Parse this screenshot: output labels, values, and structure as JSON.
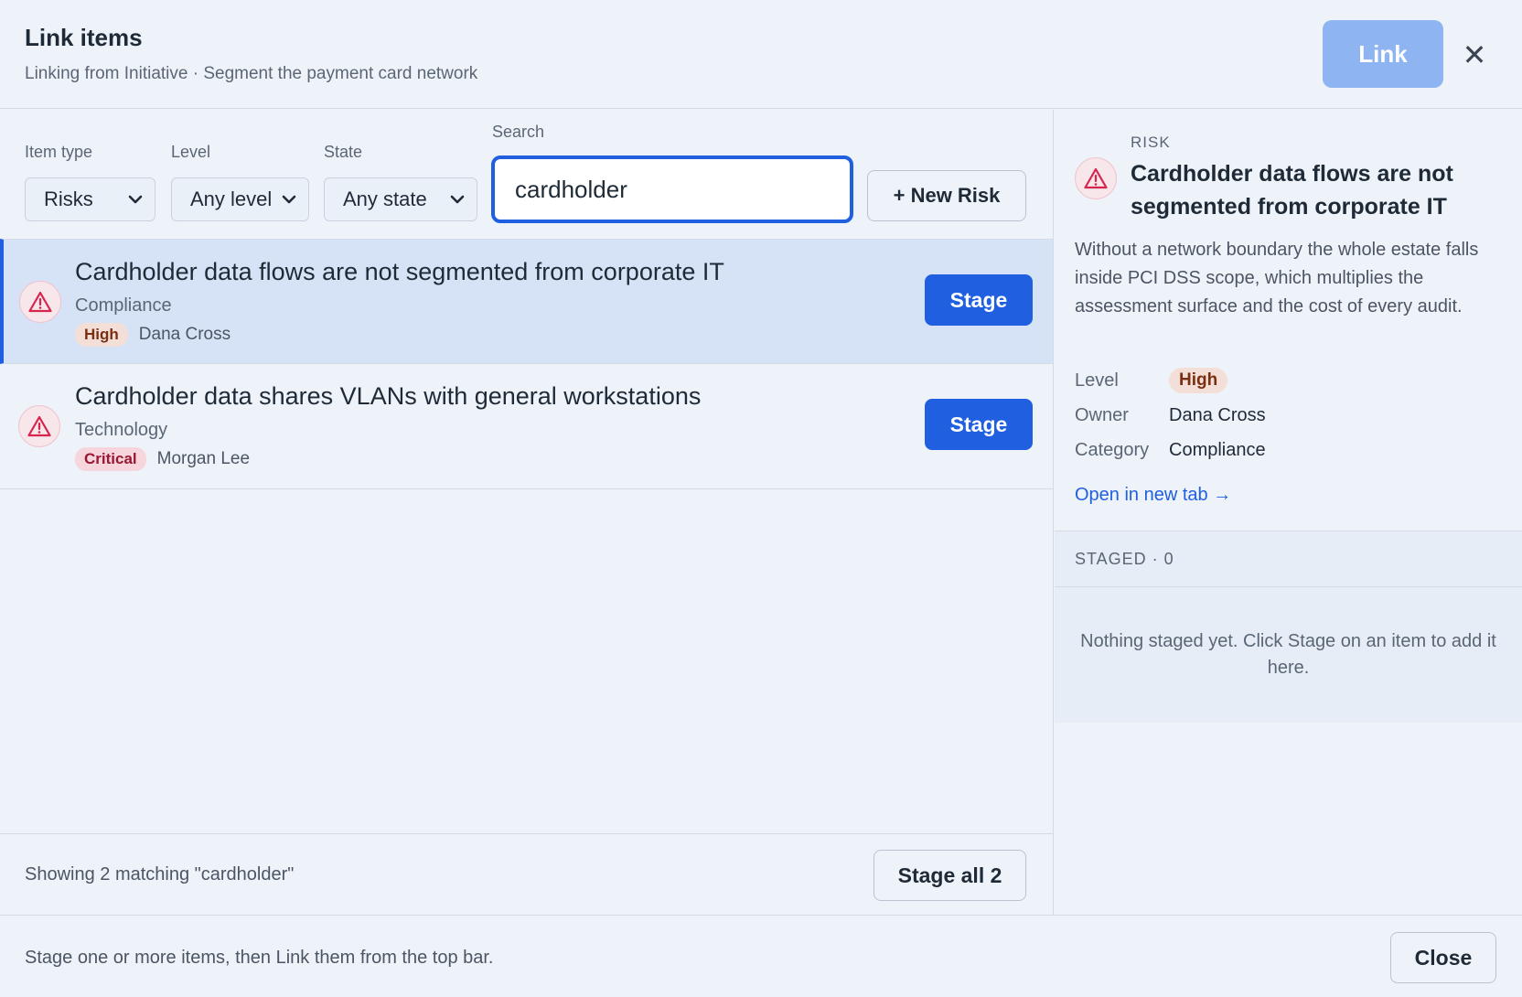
{
  "header": {
    "title": "Link items",
    "subtitle": "Linking from Initiative · Segment the payment card network",
    "link_label": "Link",
    "close_glyph": "✕"
  },
  "filters": {
    "item_type": {
      "label": "Item type",
      "value": "Risks"
    },
    "level": {
      "label": "Level",
      "value": "Any level"
    },
    "state": {
      "label": "State",
      "value": "Any state"
    },
    "search": {
      "label": "Search",
      "value": "cardholder"
    },
    "new_button": "+ New Risk"
  },
  "results": [
    {
      "title": "Cardholder data flows are not segmented from corporate IT",
      "category": "Compliance",
      "level": "High",
      "owner": "Dana Cross",
      "action": "Stage",
      "selected": true
    },
    {
      "title": "Cardholder data shares VLANs with general workstations",
      "category": "Technology",
      "level": "Critical",
      "owner": "Morgan Lee",
      "action": "Stage",
      "selected": false
    }
  ],
  "list_footer": {
    "showing": "Showing 2 matching \"cardholder\"",
    "stage_all": "Stage all 2"
  },
  "detail": {
    "kind": "RISK",
    "title": "Cardholder data flows are not segmented from corporate IT",
    "description": "Without a network boundary the whole estate falls inside PCI DSS scope, which multiplies the assessment surface and the cost of every audit.",
    "level_label": "Level",
    "level": "High",
    "owner_label": "Owner",
    "owner": "Dana Cross",
    "category_label": "Category",
    "category": "Compliance",
    "open_link": "Open in new tab →"
  },
  "staged": {
    "header": "STAGED · 0",
    "empty": "Nothing staged yet. Click Stage on an item to add it here."
  },
  "bottom": {
    "hint": "Stage one or more items, then Link them from the top bar.",
    "close": "Close"
  },
  "colors": {
    "accent": "#1f5fe0",
    "link_disabled": "#8fb4f2",
    "high_badge": "#f3dfd7",
    "critical_badge": "#f6d6dc",
    "risk_icon": "#d6264f"
  },
  "icons": {
    "risk": "warning-triangle-icon",
    "select": "chevron-down-icon",
    "close": "close-icon"
  }
}
